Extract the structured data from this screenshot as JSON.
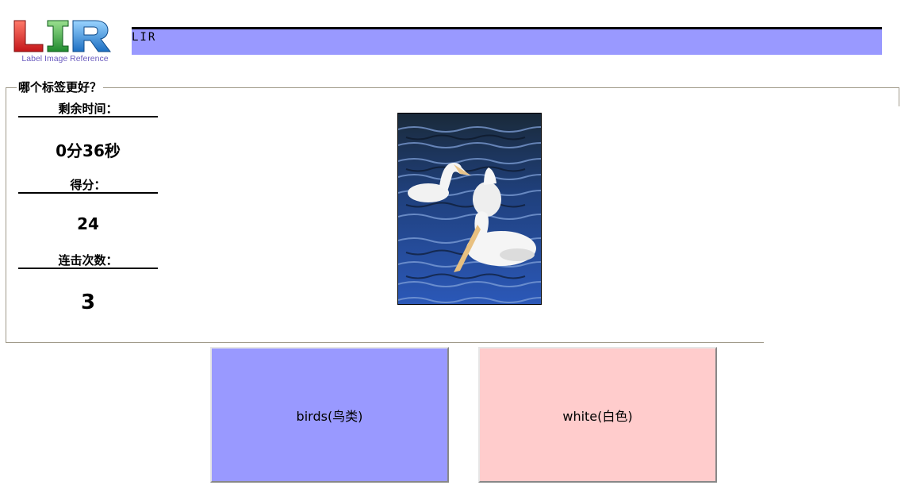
{
  "logo": {
    "letters": "LIR",
    "tagline": "Label Image Reference",
    "colors": {
      "L": "#e8342a",
      "I": "#3aa845",
      "R": "#3a8fd6",
      "tagline": "#6a5bbf"
    }
  },
  "header": {
    "title": "LIR",
    "bar_color": "#9999ff"
  },
  "game": {
    "legend": "哪个标签更好？",
    "time_label": "剩余时间：",
    "time_value": "0分36秒",
    "score_label": "得分：",
    "score_value": "24",
    "combo_label": "连击次数：",
    "combo_value": "3"
  },
  "image": {
    "subject": "pelicans on water photo"
  },
  "choices": [
    {
      "label": "birds(鸟类)",
      "color": "#9999ff"
    },
    {
      "label": "white(白色)",
      "color": "#ffcccc"
    }
  ]
}
